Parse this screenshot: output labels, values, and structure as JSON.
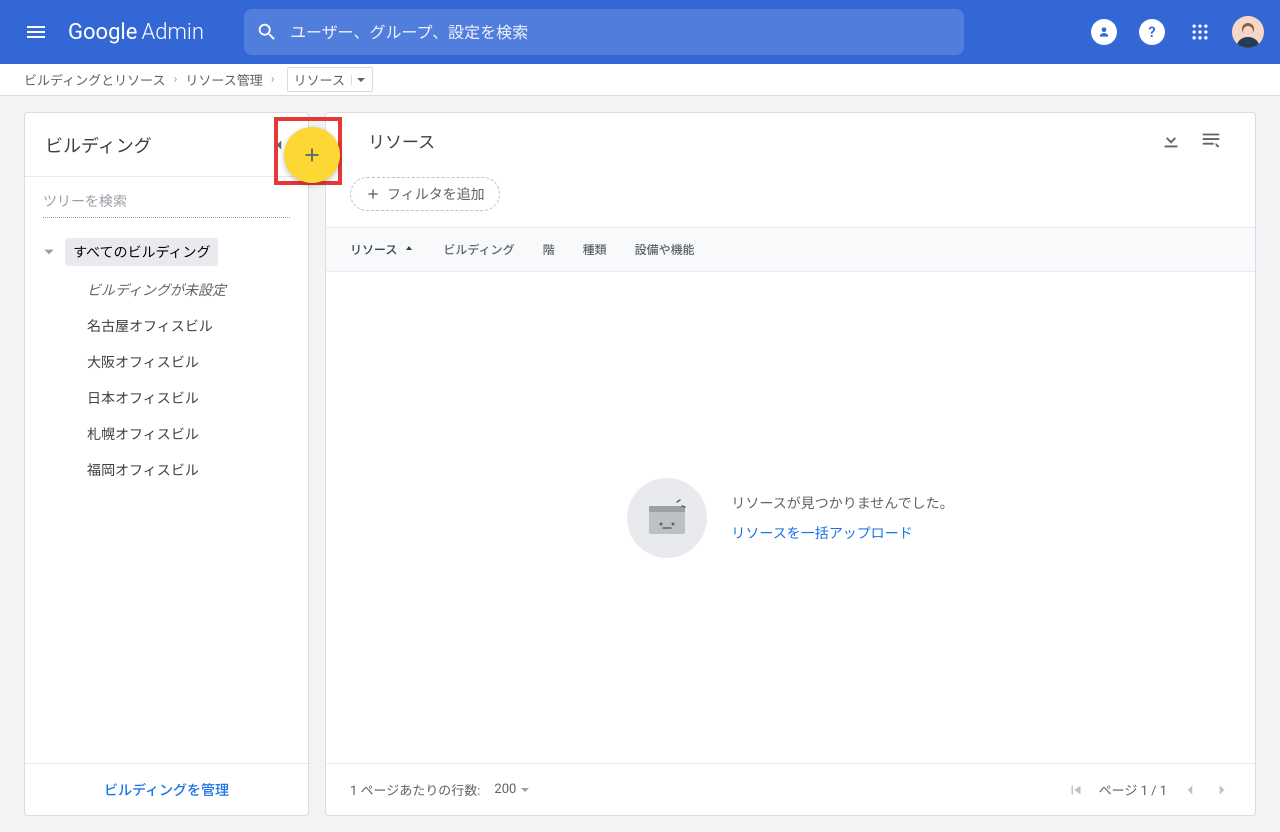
{
  "header": {
    "logo_google": "Google",
    "logo_admin": "Admin",
    "search_placeholder": "ユーザー、グループ、設定を検索"
  },
  "breadcrumb": {
    "items": [
      "ビルディングとリソース",
      "リソース管理"
    ],
    "current": "リソース"
  },
  "sidebar": {
    "title": "ビルディング",
    "search_placeholder": "ツリーを検索",
    "root_label": "すべてのビルディング",
    "items": [
      {
        "label": "ビルディングが未設定",
        "italic": true
      },
      {
        "label": "名古屋オフィスビル",
        "italic": false
      },
      {
        "label": "大阪オフィスビル",
        "italic": false
      },
      {
        "label": "日本オフィスビル",
        "italic": false
      },
      {
        "label": "札幌オフィスビル",
        "italic": false
      },
      {
        "label": "福岡オフィスビル",
        "italic": false
      }
    ],
    "manage_link": "ビルディングを管理"
  },
  "content": {
    "title": "リソース",
    "filter_label": "フィルタを追加",
    "columns": {
      "resource": "リソース",
      "building": "ビルディング",
      "floor": "階",
      "type": "種類",
      "features": "設備や機能"
    },
    "empty": {
      "message": "リソースが見つかりませんでした。",
      "upload_link": "リソースを一括アップロード"
    },
    "footer": {
      "rows_label": "1 ページあたりの行数:",
      "rows_value": "200",
      "page_label": "ページ 1 / 1"
    }
  }
}
